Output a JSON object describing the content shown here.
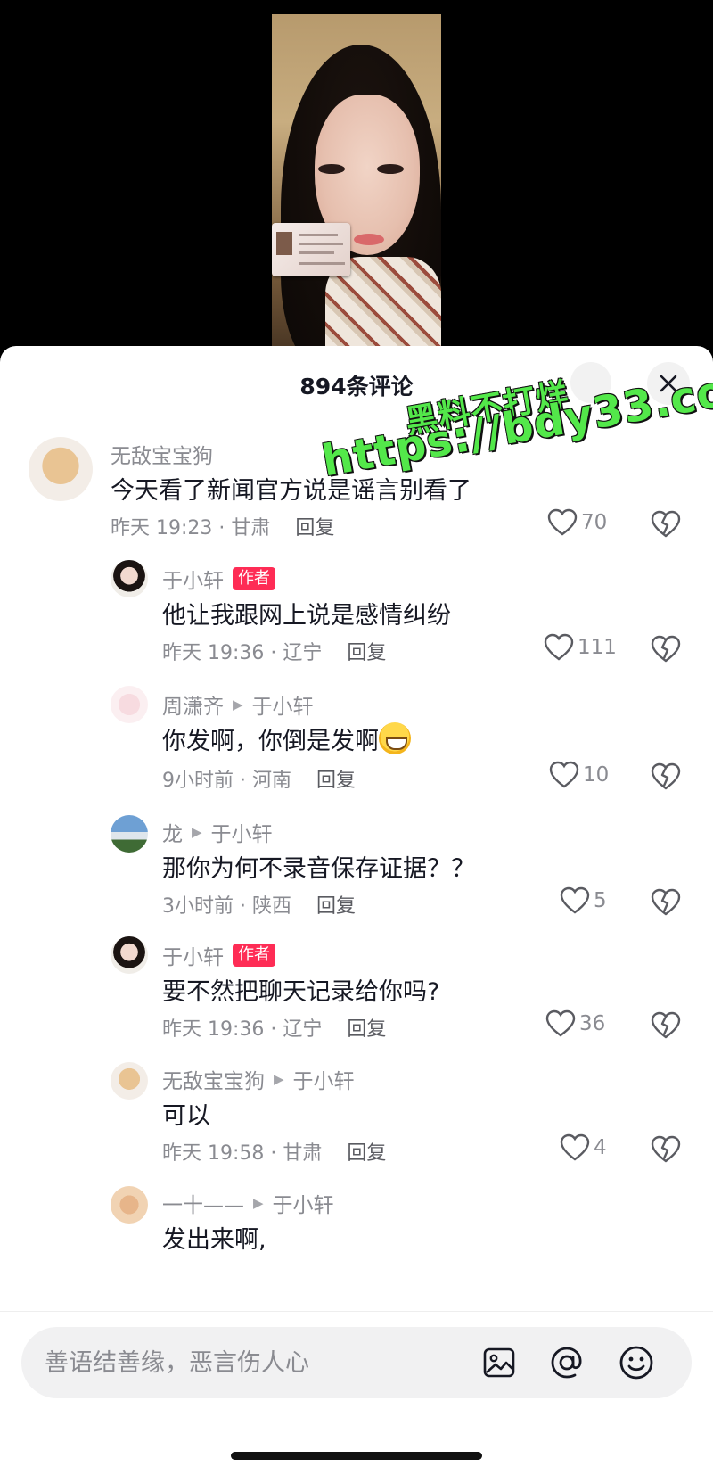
{
  "header": {
    "comment_count": "894条评论"
  },
  "watermark": {
    "line1": "黑料不打烊",
    "line2": "https://bdy33.co"
  },
  "comments": [
    {
      "user": "无敌宝宝狗",
      "reply_to": "",
      "author_tag": "",
      "text": "今天看了新闻官方说是谣言别看了",
      "time": "昨天 19:23 · 甘肃",
      "reply": "回复",
      "likes": "70",
      "avatar_icon": "dog-avatar"
    },
    {
      "user": "于小轩",
      "reply_to": "",
      "author_tag": "作者",
      "text": "他让我跟网上说是感情纠纷",
      "time": "昨天 19:36 · 辽宁",
      "reply": "回复",
      "likes": "111",
      "avatar_icon": "girl-avatar"
    },
    {
      "user": "周潇齐",
      "reply_to": "于小轩",
      "author_tag": "",
      "text": "你发啊，你倒是发啊",
      "time": "9小时前 · 河南",
      "reply": "回复",
      "likes": "10",
      "avatar_icon": "pink-avatar"
    },
    {
      "user": "龙",
      "reply_to": "于小轩",
      "author_tag": "",
      "text": "那你为何不录音保存证据？？",
      "time": "3小时前 · 陕西",
      "reply": "回复",
      "likes": "5",
      "avatar_icon": "car-avatar"
    },
    {
      "user": "于小轩",
      "reply_to": "",
      "author_tag": "作者",
      "text": "要不然把聊天记录给你吗?",
      "time": "昨天 19:36 · 辽宁",
      "reply": "回复",
      "likes": "36",
      "avatar_icon": "girl-avatar"
    },
    {
      "user": "无敌宝宝狗",
      "reply_to": "于小轩",
      "author_tag": "",
      "text": "可以",
      "time": "昨天 19:58 · 甘肃",
      "reply": "回复",
      "likes": "4",
      "avatar_icon": "dog-avatar"
    },
    {
      "user": "一十——",
      "reply_to": "于小轩",
      "author_tag": "",
      "text": "发出来啊,",
      "time": "",
      "reply": "",
      "likes": "",
      "avatar_icon": "cat-avatar"
    }
  ],
  "input": {
    "placeholder": "善语结善缘，恶言伤人心"
  },
  "colors": {
    "author_tag": "#fe2c55",
    "text_primary": "#161823",
    "text_secondary": "#8a8b91",
    "watermark": "#53e84a"
  }
}
